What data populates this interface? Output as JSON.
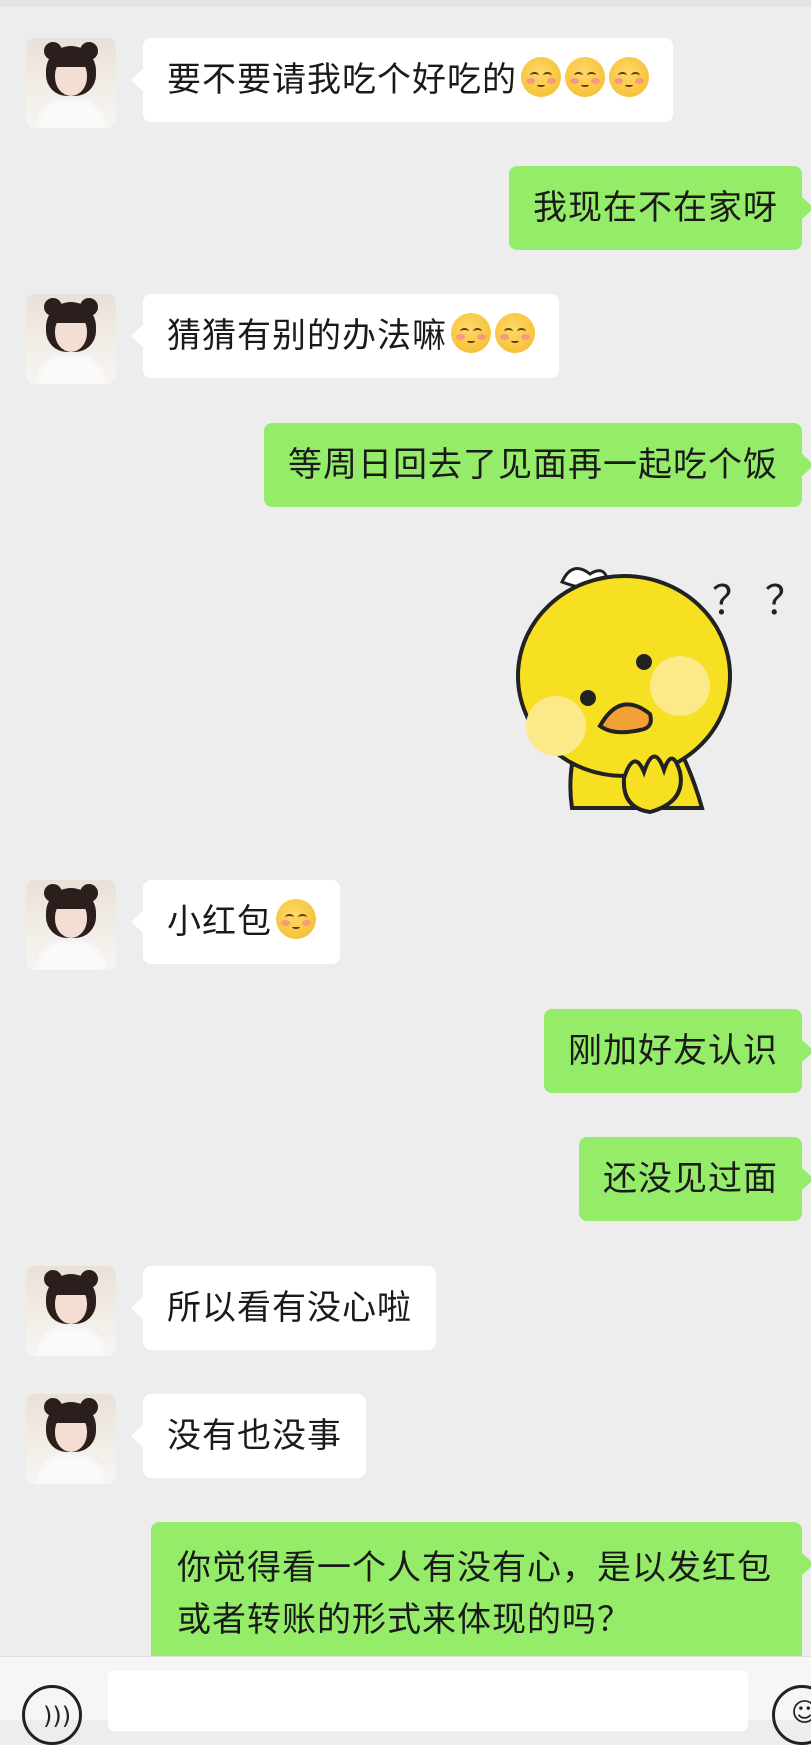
{
  "messages": [
    {
      "dir": "in",
      "text": "要不要请我吃个好吃的",
      "emojis": 3
    },
    {
      "dir": "out",
      "text": "我现在不在家呀"
    },
    {
      "dir": "in",
      "text": "猜猜有别的办法嘛",
      "emojis": 2
    },
    {
      "dir": "out",
      "text": "等周日回去了见面再一起吃个饭"
    },
    {
      "dir": "out",
      "type": "sticker",
      "sticker": "thinking-yellow-duck",
      "sticker_text": "？ ？"
    },
    {
      "dir": "in",
      "text": "小红包",
      "emojis": 1
    },
    {
      "dir": "out",
      "text": "刚加好友认识"
    },
    {
      "dir": "out",
      "text": "还没见过面"
    },
    {
      "dir": "in",
      "text": "所以看有没心啦"
    },
    {
      "dir": "in",
      "text": "没有也没事"
    },
    {
      "dir": "out",
      "text": "你觉得看一个人有没有心，是以发红包或者转账的形式来体现的吗？"
    }
  ],
  "input_bar": {
    "voice_icon": "voice-icon",
    "emoji_icon": "emoji-icon"
  },
  "colors": {
    "background": "#ededed",
    "incoming_bubble": "#ffffff",
    "outgoing_bubble": "#95ec69"
  }
}
